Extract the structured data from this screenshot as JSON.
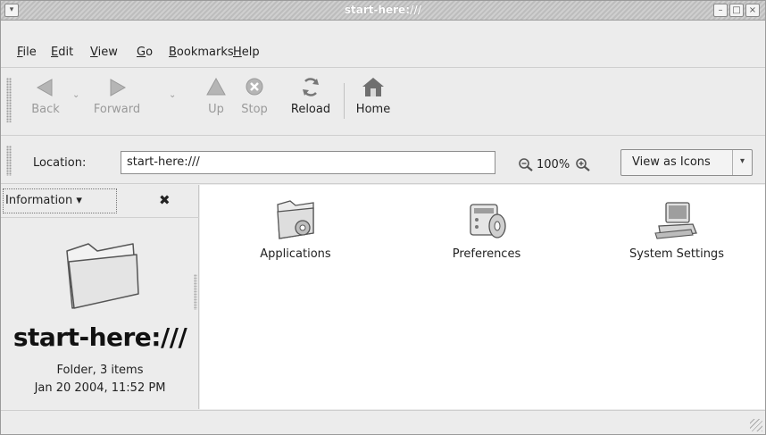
{
  "window": {
    "title": "start-here:///",
    "menu_icon": "▾",
    "minimize_icon": "–",
    "maximize_icon": "□",
    "close_icon": "×"
  },
  "menubar": [
    {
      "label": "File",
      "mnemonic": "F",
      "rest": "ile"
    },
    {
      "label": "Edit",
      "mnemonic": "E",
      "rest": "dit"
    },
    {
      "label": "View",
      "mnemonic": "V",
      "rest": "iew"
    },
    {
      "label": "Go",
      "mnemonic": "G",
      "rest": "o"
    },
    {
      "label": "Bookmarks",
      "mnemonic": "B",
      "rest": "ookmarks"
    },
    {
      "label": "Help",
      "mnemonic": "H",
      "rest": "elp"
    }
  ],
  "toolbar": {
    "back": "Back",
    "forward": "Forward",
    "up": "Up",
    "stop": "Stop",
    "reload": "Reload",
    "home": "Home",
    "dropdown_glyph": "⌄"
  },
  "location": {
    "label": "Location:",
    "value": "start-here:///",
    "zoom": "100%",
    "view_mode": "View as Icons",
    "view_arrow": "▾"
  },
  "sidepane": {
    "selector": "Information ▾",
    "close": "✖",
    "title": "start-here:///",
    "kind": "Folder, 3 items",
    "date": "Jan 20 2004, 11:52 PM"
  },
  "items": [
    {
      "label": "Applications",
      "icon": "applications-folder-icon"
    },
    {
      "label": "Preferences",
      "icon": "preferences-icon"
    },
    {
      "label": "System Settings",
      "icon": "system-settings-icon"
    }
  ],
  "colors": {
    "window_bg": "#ececec",
    "view_bg": "#ffffff",
    "titlebar": "#c6c6c6"
  }
}
